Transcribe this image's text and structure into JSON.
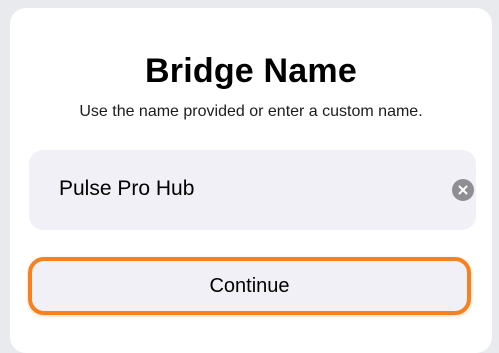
{
  "dialog": {
    "title": "Bridge Name",
    "subtitle": "Use the name provided or enter a custom name."
  },
  "name_field": {
    "value": "Pulse Pro Hub",
    "clear_icon": "clear-circle-icon"
  },
  "continue_button": {
    "label": "Continue",
    "highlight_color": "#f5821f"
  }
}
